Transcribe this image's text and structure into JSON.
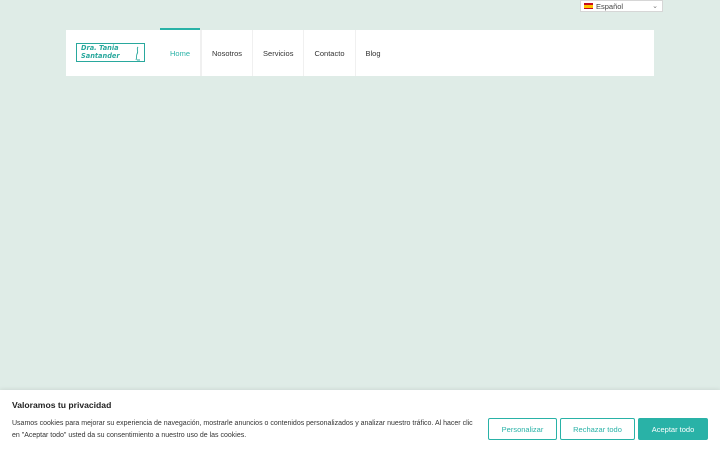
{
  "language": {
    "selected": "Español",
    "flag_icon": "spain-flag-icon"
  },
  "logo": {
    "line1": "Dra. Tania",
    "line2": "Santander",
    "color": "#29a89d"
  },
  "nav": {
    "items": [
      {
        "label": "Home",
        "active": true
      },
      {
        "label": "Nosotros"
      },
      {
        "label": "Servicios"
      },
      {
        "label": "Contacto"
      },
      {
        "label": "Blog"
      }
    ],
    "accent": "#29b2a7"
  },
  "cookie": {
    "title": "Valoramos tu privacidad",
    "text": "Usamos cookies para mejorar su experiencia de navegación, mostrarle anuncios o contenidos personalizados y analizar nuestro tráfico. Al hacer clic en \"Aceptar todo\" usted da su consentimiento a nuestro uso de las cookies.",
    "customize_label": "Personalizar",
    "reject_label": "Rechazar todo",
    "accept_label": "Aceptar todo"
  },
  "colors": {
    "background": "#dfece7",
    "accent": "#29b2a7"
  }
}
